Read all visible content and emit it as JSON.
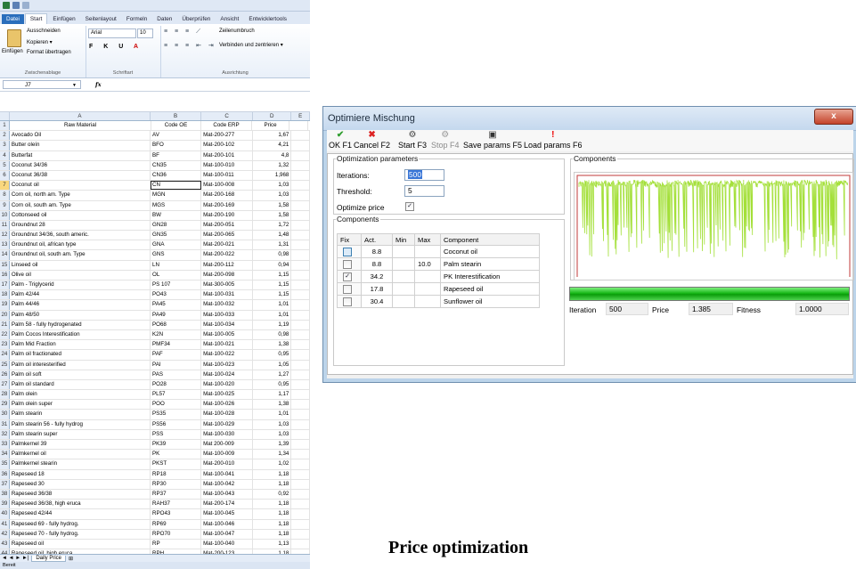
{
  "excel": {
    "ribbon_tabs": [
      "Datei",
      "Start",
      "Einfügen",
      "Seitenlayout",
      "Formeln",
      "Daten",
      "Überprüfen",
      "Ansicht",
      "Entwicklertools"
    ],
    "clipboard": {
      "cut": "Ausschneiden",
      "copy": "Kopieren ▾",
      "paste": "Einfügen",
      "format_painter": "Format übertragen",
      "group": "Zwischenablage"
    },
    "font": {
      "name": "Arial",
      "size": "10",
      "group": "Schriftart"
    },
    "alignment": {
      "wrap": "Zeilenumbruch",
      "merge": "Verbinden und zentrieren ▾",
      "group": "Ausrichtung"
    },
    "name_box": "J7",
    "fx": "fx",
    "columns": [
      "A",
      "B",
      "C",
      "D",
      "E"
    ],
    "header_row": {
      "num": "1",
      "material": "Raw Material",
      "oe": "Code OE",
      "erp": "Code ERP",
      "price": "Price"
    },
    "rows": [
      {
        "num": "2",
        "material": "Avocado Oil",
        "oe": "AV",
        "erp": "Mat-200-277",
        "price": "1,67"
      },
      {
        "num": "3",
        "material": "Butter oleín",
        "oe": "BFO",
        "erp": "Mat-200-102",
        "price": "4,21"
      },
      {
        "num": "4",
        "material": "Butterfat",
        "oe": "BF",
        "erp": "Mat-200-101",
        "price": "4,8"
      },
      {
        "num": "5",
        "material": "Coconut 34/36",
        "oe": "CN35",
        "erp": "Mat-100-010",
        "price": "1,32"
      },
      {
        "num": "6",
        "material": "Coconut 36/38",
        "oe": "CN36",
        "erp": "Mat-100-011",
        "price": "1,968"
      },
      {
        "num": "7",
        "material": "Coconut oil",
        "oe": "CN",
        "erp": "Mat-100-008",
        "price": "1,03"
      },
      {
        "num": "8",
        "material": "Corn oil, north am. Type",
        "oe": "MGN",
        "erp": "Mat-200-168",
        "price": "1,03"
      },
      {
        "num": "9",
        "material": "Corn oil, south am. Type",
        "oe": "MGS",
        "erp": "Mat-200-169",
        "price": "1,58"
      },
      {
        "num": "10",
        "material": "Cottonseed oil",
        "oe": "BW",
        "erp": "Mat-200-190",
        "price": "1,58"
      },
      {
        "num": "11",
        "material": "Groundnut 28",
        "oe": "GN28",
        "erp": "Mat-200-051",
        "price": "1,72"
      },
      {
        "num": "12",
        "material": "Groundnut 34/36, south americ.",
        "oe": "GN35",
        "erp": "Mat-200-065",
        "price": "1,48"
      },
      {
        "num": "13",
        "material": "Groundnut oil, african type",
        "oe": "GNA",
        "erp": "Mat-200-021",
        "price": "1,31"
      },
      {
        "num": "14",
        "material": "Groundnut oil, south am. Type",
        "oe": "GNS",
        "erp": "Mat-200-022",
        "price": "0,98"
      },
      {
        "num": "15",
        "material": "Linseed oil",
        "oe": "LN",
        "erp": "Mat-200-112",
        "price": "0,94"
      },
      {
        "num": "16",
        "material": "Olive oil",
        "oe": "OL",
        "erp": "Mat-200-098",
        "price": "1,15"
      },
      {
        "num": "17",
        "material": "Palm - Triglycerid",
        "oe": "PS 107",
        "erp": "Mat-300-005",
        "price": "1,15"
      },
      {
        "num": "18",
        "material": "Palm 42/44",
        "oe": "PO43",
        "erp": "Mat-100-031",
        "price": "1,15"
      },
      {
        "num": "19",
        "material": "Palm 44/46",
        "oe": "PA45",
        "erp": "Mat-100-032",
        "price": "1,01"
      },
      {
        "num": "20",
        "material": "Palm 48/50",
        "oe": "PA49",
        "erp": "Mat-100-033",
        "price": "1,01"
      },
      {
        "num": "21",
        "material": "Palm 58 - fully hydrogenated",
        "oe": "PO68",
        "erp": "Mat-100-034",
        "price": "1,19"
      },
      {
        "num": "22",
        "material": "Palm Cocos Interestification",
        "oe": "K2N",
        "erp": "Mat-100-005",
        "price": "0,98"
      },
      {
        "num": "23",
        "material": "Palm Mid Fraction",
        "oe": "PMF34",
        "erp": "Mat-100-021",
        "price": "1,38"
      },
      {
        "num": "24",
        "material": "Palm oil fractionated",
        "oe": "PAF",
        "erp": "Mat-100-022",
        "price": "0,95"
      },
      {
        "num": "25",
        "material": "Palm oil interesterified",
        "oe": "PAI",
        "erp": "Mat-100-023",
        "price": "1,05"
      },
      {
        "num": "26",
        "material": "Palm oil soft",
        "oe": "PAS",
        "erp": "Mat-100-024",
        "price": "1,27"
      },
      {
        "num": "27",
        "material": "Palm oil standard",
        "oe": "PO28",
        "erp": "Mat-100-020",
        "price": "0,95"
      },
      {
        "num": "28",
        "material": "Palm olein",
        "oe": "PL57",
        "erp": "Mat-100-025",
        "price": "1,17"
      },
      {
        "num": "29",
        "material": "Palm olein super",
        "oe": "POO",
        "erp": "Mat-100-026",
        "price": "1,38"
      },
      {
        "num": "30",
        "material": "Palm stearin",
        "oe": "PS35",
        "erp": "Mat-100-028",
        "price": "1,01"
      },
      {
        "num": "31",
        "material": "Palm stearin 56 - fully hydrog",
        "oe": "PS56",
        "erp": "Mat-100-029",
        "price": "1,03"
      },
      {
        "num": "32",
        "material": "Palm stearin super",
        "oe": "PSS",
        "erp": "Mat-100-030",
        "price": "1,03"
      },
      {
        "num": "33",
        "material": "Palmkernel 39",
        "oe": "PK39",
        "erp": "Mat 200-009",
        "price": "1,39"
      },
      {
        "num": "34",
        "material": "Palmkernel oil",
        "oe": "PK",
        "erp": "Mat-100-009",
        "price": "1,34"
      },
      {
        "num": "35",
        "material": "Palmkernel stearin",
        "oe": "PKST",
        "erp": "Mat-200-010",
        "price": "1,02"
      },
      {
        "num": "36",
        "material": "Rapeseed 18",
        "oe": "RP18",
        "erp": "Mat-100-041",
        "price": "1,18"
      },
      {
        "num": "37",
        "material": "Rapeseed 30",
        "oe": "RP30",
        "erp": "Mat-100-042",
        "price": "1,18"
      },
      {
        "num": "38",
        "material": "Rapeseed 36/38",
        "oe": "RP37",
        "erp": "Mat-100-043",
        "price": "0,92"
      },
      {
        "num": "39",
        "material": "Rapeseed 36/38, high eruca",
        "oe": "RAH37",
        "erp": "Mat-200-174",
        "price": "1,18"
      },
      {
        "num": "40",
        "material": "Rapeseed 42/44",
        "oe": "RPO43",
        "erp": "Mat-100-045",
        "price": "1,18"
      },
      {
        "num": "41",
        "material": "Rapeseed 69 - fully hydrog.",
        "oe": "RP69",
        "erp": "Mat-100-046",
        "price": "1,18"
      },
      {
        "num": "42",
        "material": "Rapeseed 70 - fully hydrog.",
        "oe": "RPO70",
        "erp": "Mat-100-047",
        "price": "1,18"
      },
      {
        "num": "43",
        "material": "Rapeseed oil",
        "oe": "RP",
        "erp": "Mat-100-040",
        "price": "1,13"
      },
      {
        "num": "44",
        "material": "Rapeseed oil, high eruca",
        "oe": "RPH",
        "erp": "Mat-200-123",
        "price": "1,18"
      },
      {
        "num": "45",
        "material": "Safflower oil, high linoleic",
        "oe": "SA HL",
        "erp": "Mat-100-081",
        "price": "1,18"
      },
      {
        "num": "46",
        "material": "Safflower oil, high oleic",
        "oe": "SA HO",
        "erp": "Mat-100-082",
        "price": "1,36"
      },
      {
        "num": "47",
        "material": "Sesame oil",
        "oe": "SS",
        "erp": "Mat-200-211",
        "price": "1,49"
      }
    ],
    "sheet_nav": "◄ ◄ ► ►|",
    "sheet_tab": "Daily Price",
    "status": "Bereit"
  },
  "dialog": {
    "title": "Optimiere Mischung",
    "close": "x",
    "toolbar": [
      {
        "label": "OK F1",
        "icon": "ok-icon",
        "glyph": "✔",
        "enabled": true
      },
      {
        "label": "Cancel F2",
        "icon": "cancel-icon",
        "glyph": "✖",
        "enabled": true
      },
      {
        "label": "Start F3",
        "icon": "start-gear-icon",
        "glyph": "⚙",
        "enabled": true
      },
      {
        "label": "Stop F4",
        "icon": "stop-gear-icon",
        "glyph": "⚙",
        "enabled": false
      },
      {
        "label": "Save params F5",
        "icon": "save-disk-icon",
        "glyph": "▣",
        "enabled": true
      },
      {
        "label": "Load params F6",
        "icon": "load-exclamation-icon",
        "glyph": "!",
        "enabled": true
      }
    ],
    "optimization": {
      "legend": "Optimization parameters",
      "iterations_label": "Iterations:",
      "iterations_value": "500",
      "threshold_label": "Threshold:",
      "threshold_value": "5",
      "optimize_price_label": "Optimize price",
      "optimize_price_checked": true
    },
    "components": {
      "legend": "Components",
      "headers": [
        "Fix",
        "Act.",
        "Min",
        "Max",
        "Component"
      ],
      "rows": [
        {
          "fix": false,
          "act": "8.8",
          "min": "",
          "max": "",
          "component": "Coconut oil"
        },
        {
          "fix": false,
          "act": "8.8",
          "min": "",
          "max": "10.0",
          "component": "Palm stearin"
        },
        {
          "fix": true,
          "act": "34.2",
          "min": "",
          "max": "",
          "component": "PK Interestification"
        },
        {
          "fix": false,
          "act": "17.8",
          "min": "",
          "max": "",
          "component": "Rapeseed oil"
        },
        {
          "fix": false,
          "act": "30.4",
          "min": "",
          "max": "",
          "component": "Sunflower oil"
        }
      ]
    },
    "chart_legend": "Components",
    "progress": 1.0,
    "stats": {
      "iteration_label": "Iteration",
      "iteration_value": "500",
      "price_label": "Price",
      "price_value": "1.385",
      "fitness_label": "Fitness",
      "fitness_value": "1.0000"
    },
    "colors": {
      "chart_line": "#a4e03a",
      "chart_frame": "#c23a3a",
      "progress": "#18b818"
    }
  },
  "caption": "Price optimization"
}
